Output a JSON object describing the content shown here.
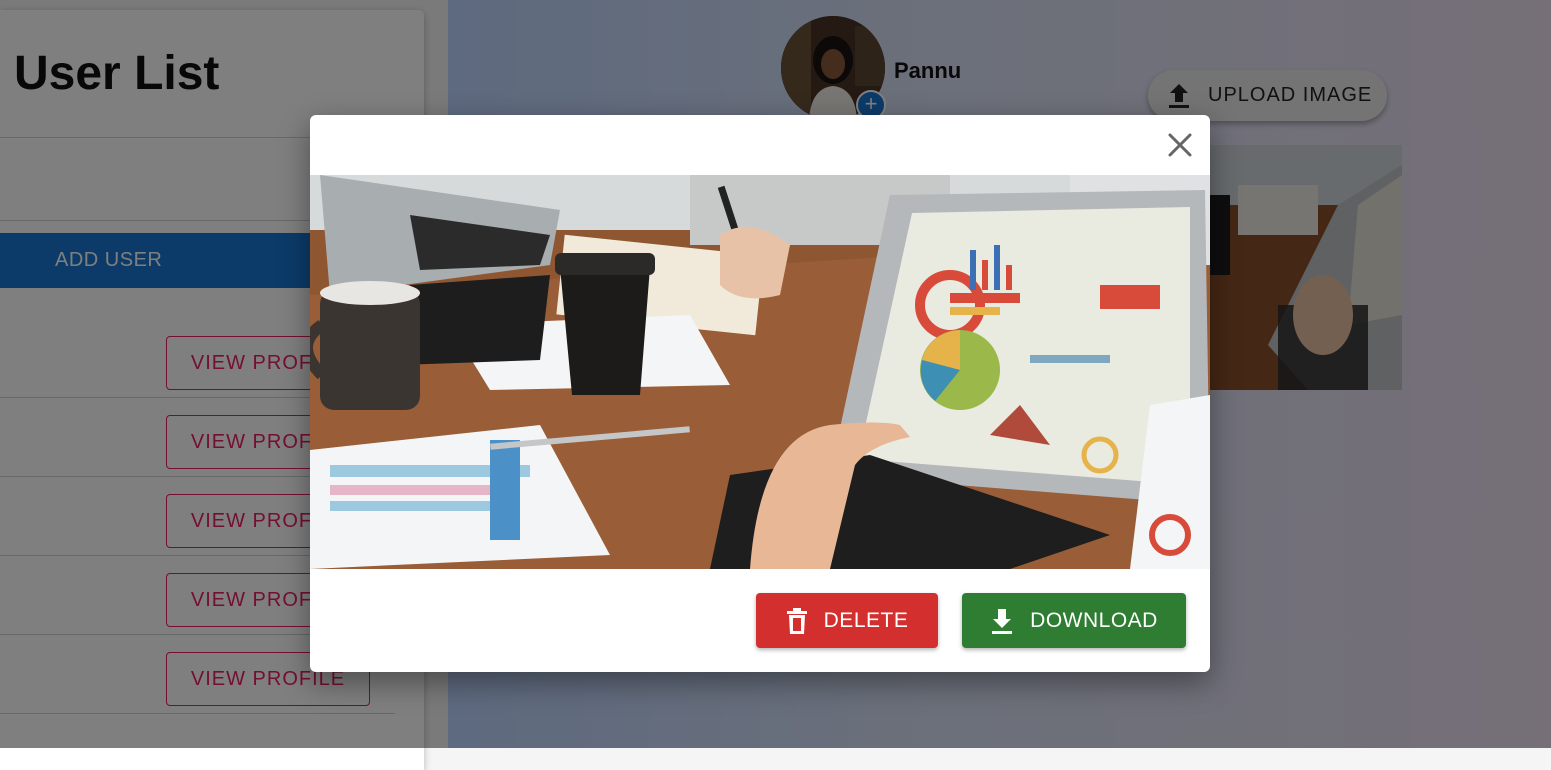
{
  "left_panel": {
    "title": "User List",
    "add_user_label": "ADD USER",
    "rows": [
      {
        "view_label": "VIEW PROFILE"
      },
      {
        "view_label": "VIEW PROFILE"
      },
      {
        "view_label": "VIEW PROFILE"
      },
      {
        "view_label": "VIEW PROFILE"
      },
      {
        "view_label": "VIEW PROFILE"
      }
    ]
  },
  "profile": {
    "name": "Pannu",
    "avatar_icon": "add-icon",
    "upload_label": "UPLOAD IMAGE",
    "upload_icon": "upload-icon"
  },
  "modal": {
    "close_icon": "close-icon",
    "delete_label": "DELETE",
    "delete_icon": "trash-icon",
    "download_label": "DOWNLOAD",
    "download_icon": "download-icon"
  },
  "colors": {
    "primary": "#1976d2",
    "secondary": "#e91e63",
    "delete": "#d32f2f",
    "download": "#2e7d32"
  }
}
